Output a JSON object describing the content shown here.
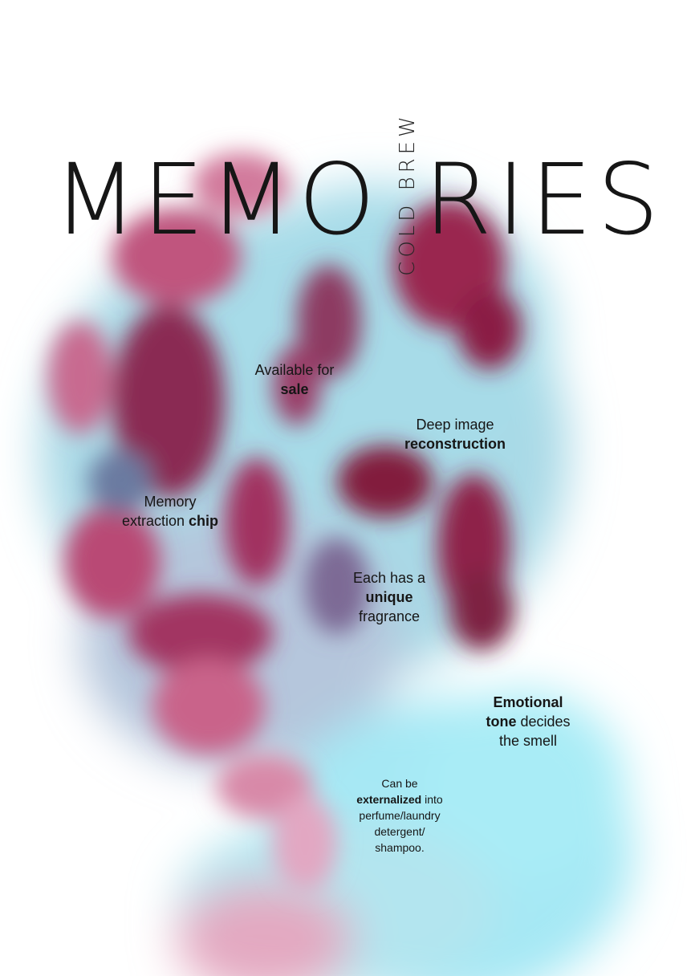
{
  "title": {
    "left": "MEMO",
    "right": "RIES",
    "subtitle": "COLD BREW"
  },
  "notes": {
    "sale": {
      "normal": "Available for",
      "bold": "sale"
    },
    "reconstruction": {
      "normal": "Deep image",
      "bold": "reconstruction"
    },
    "chip": {
      "normal1": "Memory",
      "normal2": "extraction ",
      "bold": "chip"
    },
    "fragrance": {
      "normal1": "Each has a",
      "bold": "unique",
      "normal2": "fragrance"
    },
    "emotional": {
      "bold1": "Emotional",
      "bold2": "tone",
      "normal1": " decides",
      "normal2": "the smell"
    },
    "externalized": {
      "normal1": "Can be",
      "bold": "externalized",
      "normal2": " into",
      "normal3": "perfume/laundry",
      "normal4": "detergent/",
      "normal5": "shampoo."
    }
  },
  "colors": {
    "cyan": "#9fdfea",
    "magenta": "#8a1f45",
    "pink": "#c8507a",
    "text": "#161616"
  }
}
